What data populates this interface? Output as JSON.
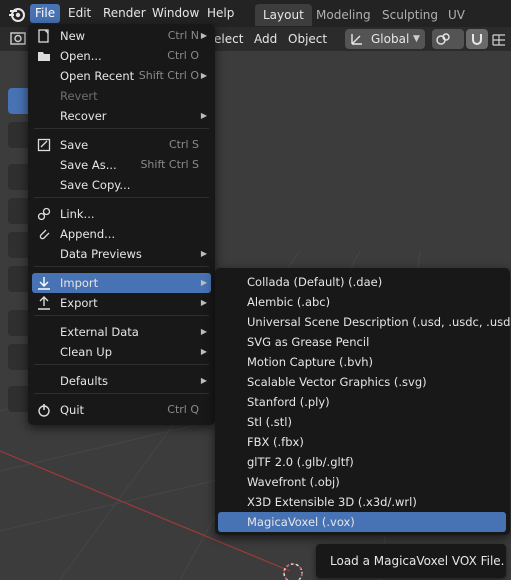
{
  "topbar": {
    "menus": [
      "File",
      "Edit",
      "Render",
      "Window",
      "Help"
    ],
    "workspaces": [
      "Layout",
      "Modeling",
      "Sculpting",
      "UV Editing"
    ],
    "active_workspace": "Layout",
    "active_menu": "File"
  },
  "header": {
    "select_partial": "elect",
    "add": "Add",
    "object": "Object",
    "orientation": "Global"
  },
  "file_menu": [
    {
      "label": "New",
      "shortcut": "Ctrl N",
      "submenu": true,
      "icon": "new-file-icon"
    },
    {
      "label": "Open...",
      "shortcut": "Ctrl O",
      "icon": "folder-icon"
    },
    {
      "label": "Open Recent",
      "shortcut": "Shift Ctrl O",
      "submenu": true
    },
    {
      "label": "Revert",
      "disabled": true
    },
    {
      "label": "Recover",
      "submenu": true
    },
    {
      "label": "Save",
      "shortcut": "Ctrl S",
      "icon": "save-icon"
    },
    {
      "label": "Save As...",
      "shortcut": "Shift Ctrl S"
    },
    {
      "label": "Save Copy..."
    },
    {
      "label": "Link...",
      "icon": "link-icon"
    },
    {
      "label": "Append...",
      "icon": "paperclip-icon"
    },
    {
      "label": "Data Previews",
      "submenu": true
    },
    {
      "label": "Import",
      "submenu": true,
      "icon": "import-icon",
      "highlighted": true
    },
    {
      "label": "Export",
      "submenu": true,
      "icon": "export-icon"
    },
    {
      "label": "External Data",
      "submenu": true
    },
    {
      "label": "Clean Up",
      "submenu": true
    },
    {
      "label": "Defaults",
      "submenu": true
    },
    {
      "label": "Quit",
      "shortcut": "Ctrl Q",
      "icon": "power-icon"
    }
  ],
  "import_menu": [
    "Collada (Default) (.dae)",
    "Alembic (.abc)",
    "Universal Scene Description (.usd, .usdc, .usda)",
    "SVG as Grease Pencil",
    "Motion Capture (.bvh)",
    "Scalable Vector Graphics (.svg)",
    "Stanford (.ply)",
    "Stl (.stl)",
    "FBX (.fbx)",
    "glTF 2.0 (.glb/.gltf)",
    "Wavefront (.obj)",
    "X3D Extensible 3D (.x3d/.wrl)",
    "MagicaVoxel (.vox)"
  ],
  "import_highlighted": "MagicaVoxel (.vox)",
  "tooltip": "Load a MagicaVoxel VOX File.",
  "colors": {
    "accent": "#4772b3",
    "menu_bg": "#181818",
    "topbar_bg": "#232323"
  }
}
